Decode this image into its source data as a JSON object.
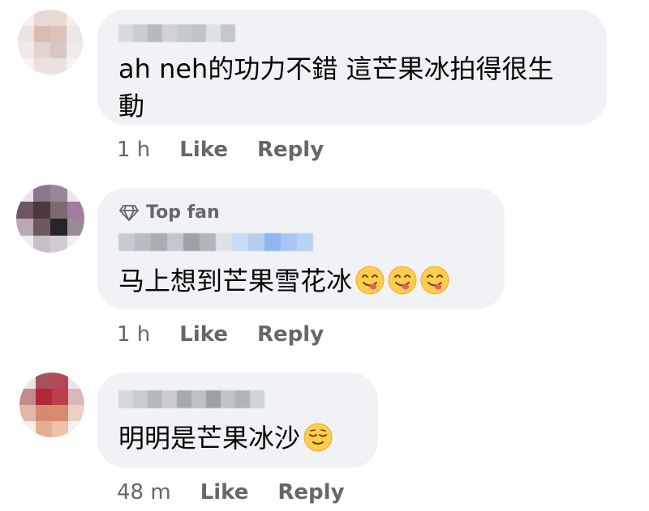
{
  "comments": [
    {
      "author_hidden": true,
      "text_line1": "ah neh的功力不錯 這芒果冰拍得很生",
      "text_line2": "動",
      "time": "1 h",
      "like_label": "Like",
      "reply_label": "Reply"
    },
    {
      "badge_label": "Top fan",
      "author_hidden": true,
      "text": "马上想到芒果雪花冰",
      "emojis": [
        "yum-face-icon",
        "yum-face-icon",
        "yum-face-icon"
      ],
      "time": "1 h",
      "like_label": "Like",
      "reply_label": "Reply"
    },
    {
      "author_hidden": true,
      "text": "明明是芒果冰沙",
      "emojis": [
        "relieved-face-icon"
      ],
      "time": "48 m",
      "like_label": "Like",
      "reply_label": "Reply"
    }
  ],
  "colors": {
    "bubble": "#f0f2f5",
    "secondary_text": "#65676b",
    "primary_text": "#050505"
  }
}
